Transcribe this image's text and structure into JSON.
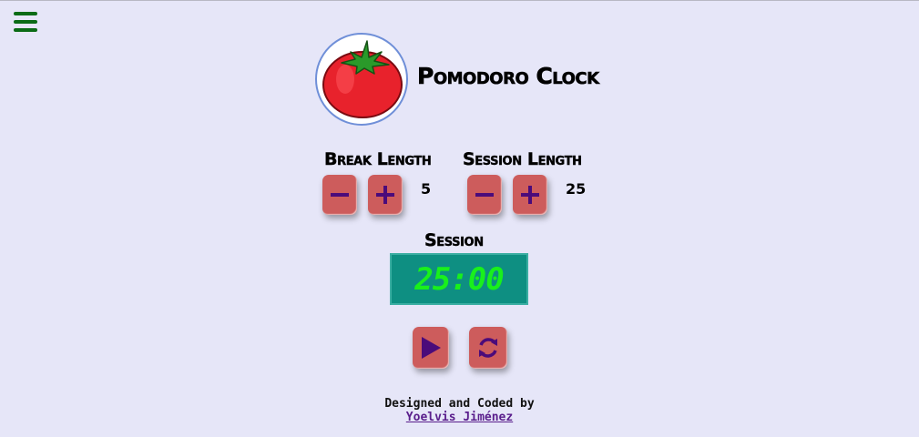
{
  "app": {
    "title": "Pomodoro Clock"
  },
  "menu": {
    "icon": "hamburger-menu-icon"
  },
  "logo": {
    "icon": "tomato-icon"
  },
  "break": {
    "label": "Break Length",
    "value": "5"
  },
  "session": {
    "label": "Session Length",
    "value": "25"
  },
  "timer": {
    "label": "Session",
    "time": "25:00"
  },
  "controls": {
    "play_icon": "play-icon",
    "reset_icon": "refresh-icon"
  },
  "footer": {
    "line1": "Designed and Coded by",
    "author": "Yoelvis Jiménez"
  },
  "colors": {
    "background": "#e6e6f8",
    "button": "#cd5c5c",
    "icon": "#4b0b7a",
    "display_bg": "#0e8f82",
    "display_text": "#19f01c",
    "menu": "#0b6b16"
  }
}
